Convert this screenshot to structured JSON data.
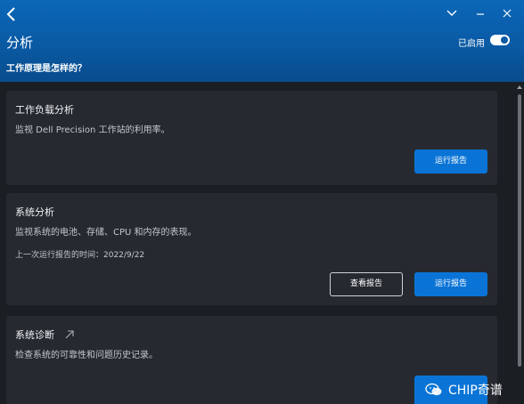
{
  "header": {
    "title": "分析",
    "toggle_label": "已启用",
    "toggle_on": true,
    "how_link": "工作原理是怎样的？"
  },
  "cards": [
    {
      "title": "工作负载分析",
      "description": "监视 Dell Precision 工作站的利用率。",
      "primary_button": "运行报告"
    },
    {
      "title": "系统分析",
      "description": "监视系统的电池、存储、CPU 和内存的表现。",
      "meta": "上一次运行报告的时间：2022/9/22",
      "secondary_button": "查看报告",
      "primary_button": "运行报告"
    },
    {
      "title": "系统诊断",
      "description": "检查系统的可靠性和问题历史记录。",
      "icon": "external-arrow-icon"
    }
  ],
  "watermark": {
    "text": "CHIP奇谱"
  },
  "colors": {
    "header": "#0a5aa4",
    "background": "#1b1f24",
    "card": "#262a30",
    "accent": "#0a74d6"
  }
}
